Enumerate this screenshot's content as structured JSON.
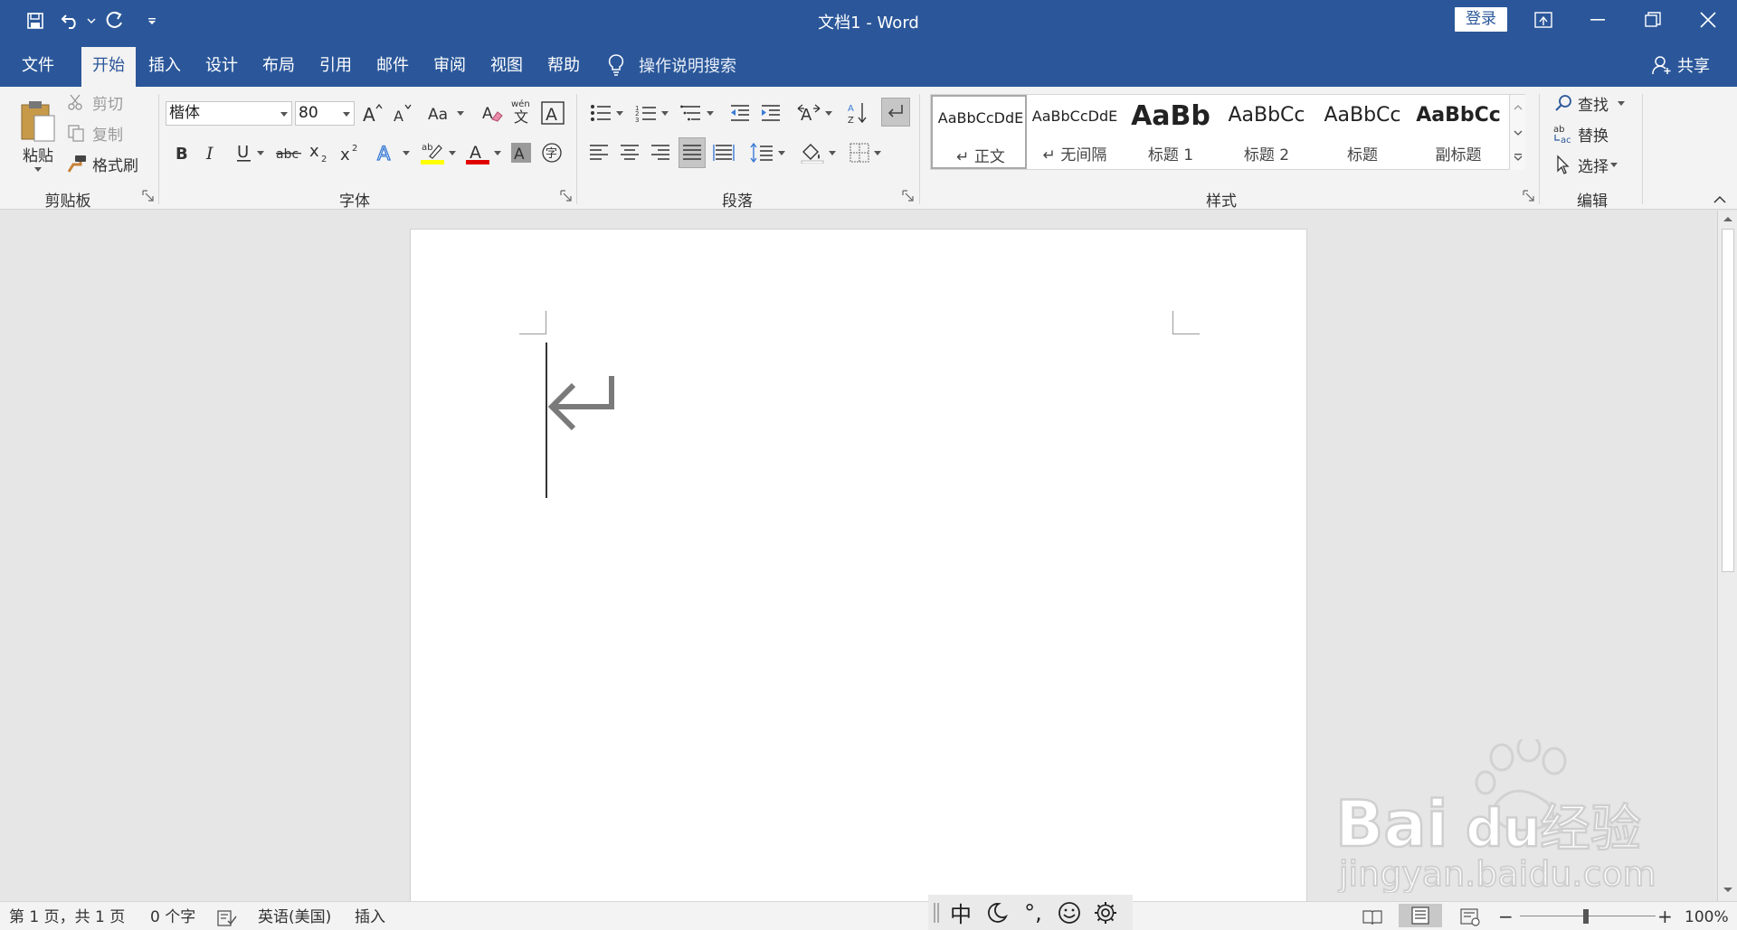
{
  "window": {
    "title": "文档1  -  Word",
    "login_label": "登录"
  },
  "tabs": [
    {
      "label": "文件"
    },
    {
      "label": "开始"
    },
    {
      "label": "插入"
    },
    {
      "label": "设计"
    },
    {
      "label": "布局"
    },
    {
      "label": "引用"
    },
    {
      "label": "邮件"
    },
    {
      "label": "审阅"
    },
    {
      "label": "视图"
    },
    {
      "label": "帮助"
    }
  ],
  "tell_me": {
    "placeholder": "操作说明搜索"
  },
  "share_label": "共享",
  "ribbon": {
    "clipboard": {
      "label": "剪贴板",
      "paste": "粘贴",
      "cut": "剪切",
      "copy": "复制",
      "format_painter": "格式刷"
    },
    "font": {
      "label": "字体",
      "font_name": "楷体",
      "font_size": "80"
    },
    "paragraph": {
      "label": "段落"
    },
    "styles": {
      "label": "样式",
      "items": [
        {
          "sample": "AaBbCcDdE",
          "name": "正文"
        },
        {
          "sample": "AaBbCcDdE",
          "name": "无间隔"
        },
        {
          "sample": "AaBb",
          "name": "标题 1"
        },
        {
          "sample": "AaBbCc",
          "name": "标题 2"
        },
        {
          "sample": "AaBbCc",
          "name": "标题"
        },
        {
          "sample": "AaBbCc",
          "name": "副标题"
        }
      ]
    },
    "editing": {
      "label": "编辑",
      "find": "查找",
      "replace": "替换",
      "select": "选择"
    }
  },
  "statusbar": {
    "page": "第 1 页，共 1 页",
    "words": "0 个字",
    "language": "英语(美国)",
    "mode": "插入",
    "zoom": "100%"
  },
  "ime": {
    "mode": "中",
    "punct": "°,"
  },
  "watermark": {
    "brand": "Bai",
    "brand2": "du",
    "cn": "经验",
    "url": "jingyan.baidu.com"
  },
  "colors": {
    "accent": "#2b579a",
    "highlight": "#ffff00",
    "font_color": "#e00000"
  }
}
